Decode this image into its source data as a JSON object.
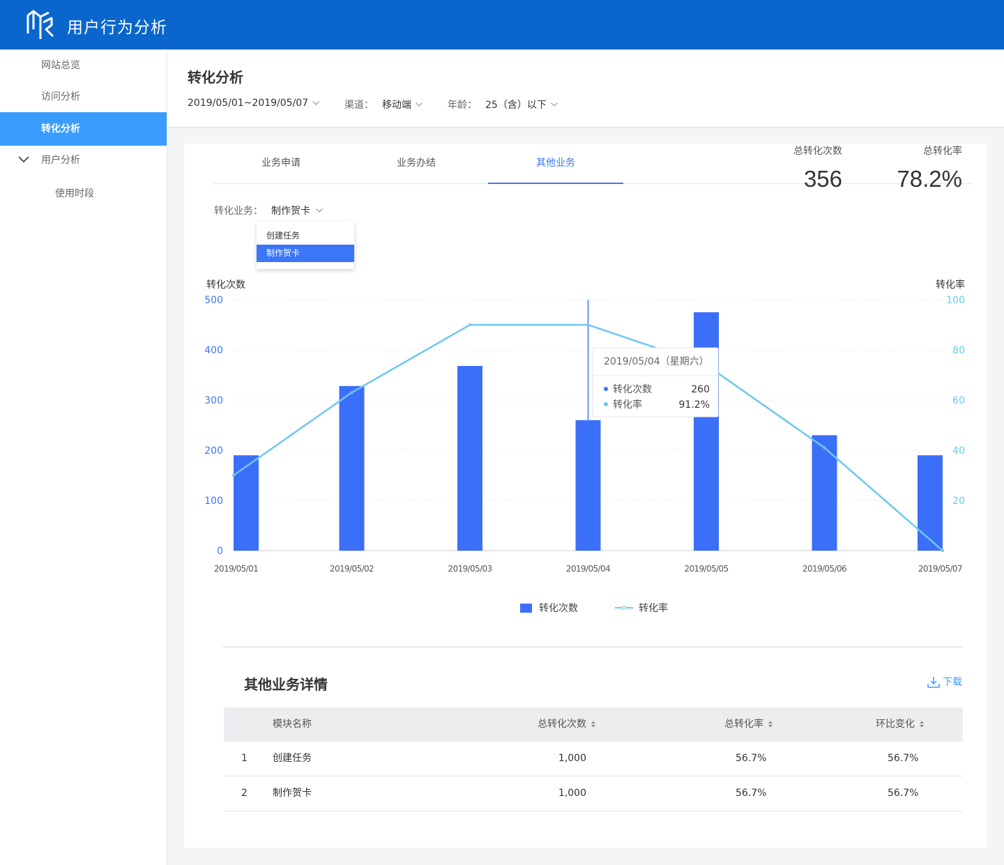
{
  "app": {
    "title": "用户行为分析"
  },
  "sidebar": {
    "items": [
      {
        "label": "网站总览"
      },
      {
        "label": "访问分析"
      },
      {
        "label": "转化分析"
      },
      {
        "label": "用户分析"
      },
      {
        "label": "使用时段"
      }
    ]
  },
  "page": {
    "title": "转化分析",
    "filters": {
      "date_range": "2019/05/01~2019/05/07",
      "channel_label": "渠道：",
      "channel_value": "移动端",
      "age_label": "年龄：",
      "age_value": "25（含）以下"
    }
  },
  "tabs": [
    {
      "label": "业务申请"
    },
    {
      "label": "业务办结"
    },
    {
      "label": "其他业务"
    }
  ],
  "business_select": {
    "label": "转化业务：",
    "value": "制作贺卡",
    "options": [
      "创建任务",
      "制作贺卡"
    ]
  },
  "stats": {
    "total_count_label": "总转化次数",
    "total_count_value": "356",
    "total_rate_label": "总转化率",
    "total_rate_value": "78.2%"
  },
  "chart_data": {
    "type": "bar",
    "categories": [
      "2019/05/01",
      "2019/05/02",
      "2019/05/03",
      "2019/05/04",
      "2019/05/05",
      "2019/05/06",
      "2019/05/07"
    ],
    "series": [
      {
        "name": "转化次数",
        "type": "bar",
        "axis": "left",
        "values": [
          190,
          328,
          368,
          260,
          475,
          230,
          190
        ]
      },
      {
        "name": "转化率",
        "type": "line",
        "axis": "right",
        "values": [
          30,
          63,
          90,
          90,
          74,
          41,
          0
        ]
      }
    ],
    "ylabel": "转化次数",
    "ylabel_right": "转化率",
    "ylim": [
      0,
      500
    ],
    "ylim_right": [
      0,
      100
    ],
    "yticks": [
      0,
      100,
      200,
      300,
      400,
      500
    ],
    "yticks_right": [
      20,
      40,
      60,
      80,
      100
    ],
    "grid": true,
    "legend": "bottom",
    "colors": {
      "bar": "#3b6ff8",
      "line": "#6cc8f0",
      "axis_left": "#3b76f6",
      "axis_right": "#5cd0f0"
    },
    "tooltip": {
      "index": 3,
      "title": "2019/05/04（星期六）",
      "rows": [
        {
          "label": "转化次数",
          "value": "260"
        },
        {
          "label": "转化率",
          "value": "91.2%"
        }
      ]
    }
  },
  "detail": {
    "title": "其他业务详情",
    "download_label": "下载",
    "columns": [
      "模块名称",
      "总转化次数",
      "总转化率",
      "环比变化"
    ],
    "rows": [
      {
        "index": "1",
        "name": "创建任务",
        "count": "1,000",
        "rate": "56.7%",
        "change": "56.7%"
      },
      {
        "index": "2",
        "name": "制作贺卡",
        "count": "1,000",
        "rate": "56.7%",
        "change": "56.7%"
      }
    ]
  }
}
